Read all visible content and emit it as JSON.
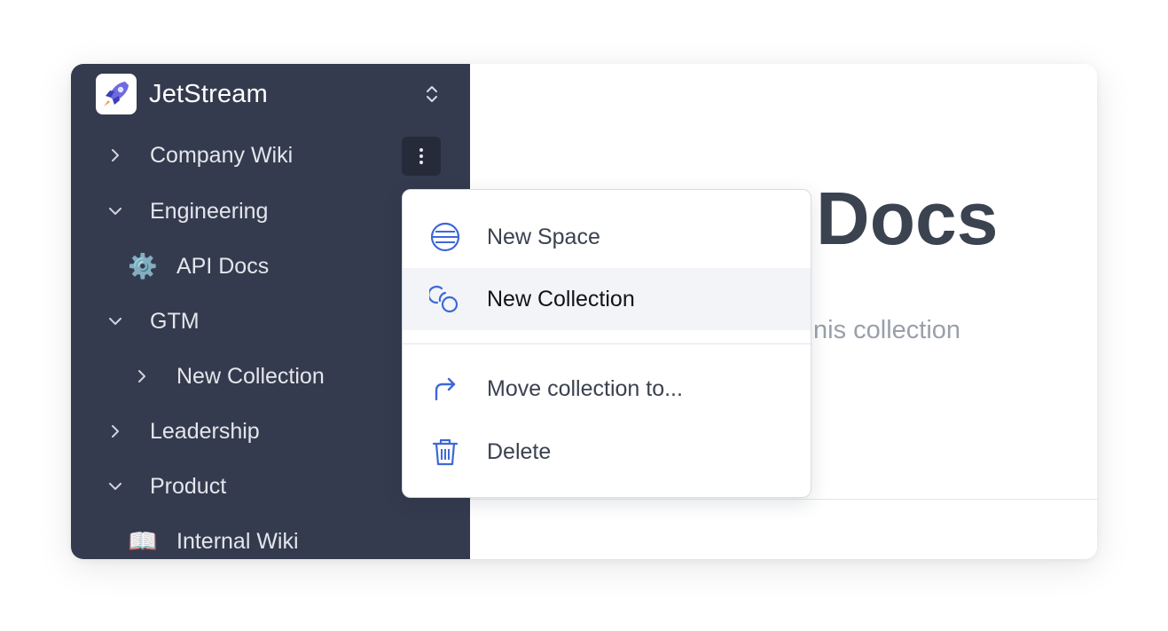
{
  "workspace": {
    "name": "JetStream",
    "logo": "rocket-icon",
    "switch_icon": "chevron-up-down-icon"
  },
  "sidebar": {
    "items": [
      {
        "label": "Company Wiki",
        "icon": "chevron-right-icon"
      },
      {
        "label": "Engineering",
        "icon": "chevron-down-icon"
      },
      {
        "label": "API Docs",
        "emoji": "⚙️"
      },
      {
        "label": "GTM",
        "icon": "chevron-down-icon"
      },
      {
        "label": "New Collection",
        "icon": "chevron-right-icon"
      },
      {
        "label": "Leadership",
        "icon": "chevron-right-icon"
      },
      {
        "label": "Product",
        "icon": "chevron-down-icon"
      },
      {
        "label": "Internal Wiki",
        "emoji": "📖"
      }
    ],
    "more_icon": "more-vertical-icon"
  },
  "main": {
    "title": "Topic Docs",
    "title_visible": "c Docs",
    "description_visible": "nis collection"
  },
  "context_menu": {
    "items": [
      {
        "label": "New Space",
        "icon": "space-icon"
      },
      {
        "label": "New Collection",
        "icon": "collection-icon",
        "highlighted": true
      },
      {
        "label": "Move collection to...",
        "icon": "move-arrow-icon"
      },
      {
        "label": "Delete",
        "icon": "trash-icon"
      }
    ]
  },
  "colors": {
    "sidebar_bg": "#353b4e",
    "accent": "#3d68d8",
    "text_dark": "#3b4350"
  }
}
